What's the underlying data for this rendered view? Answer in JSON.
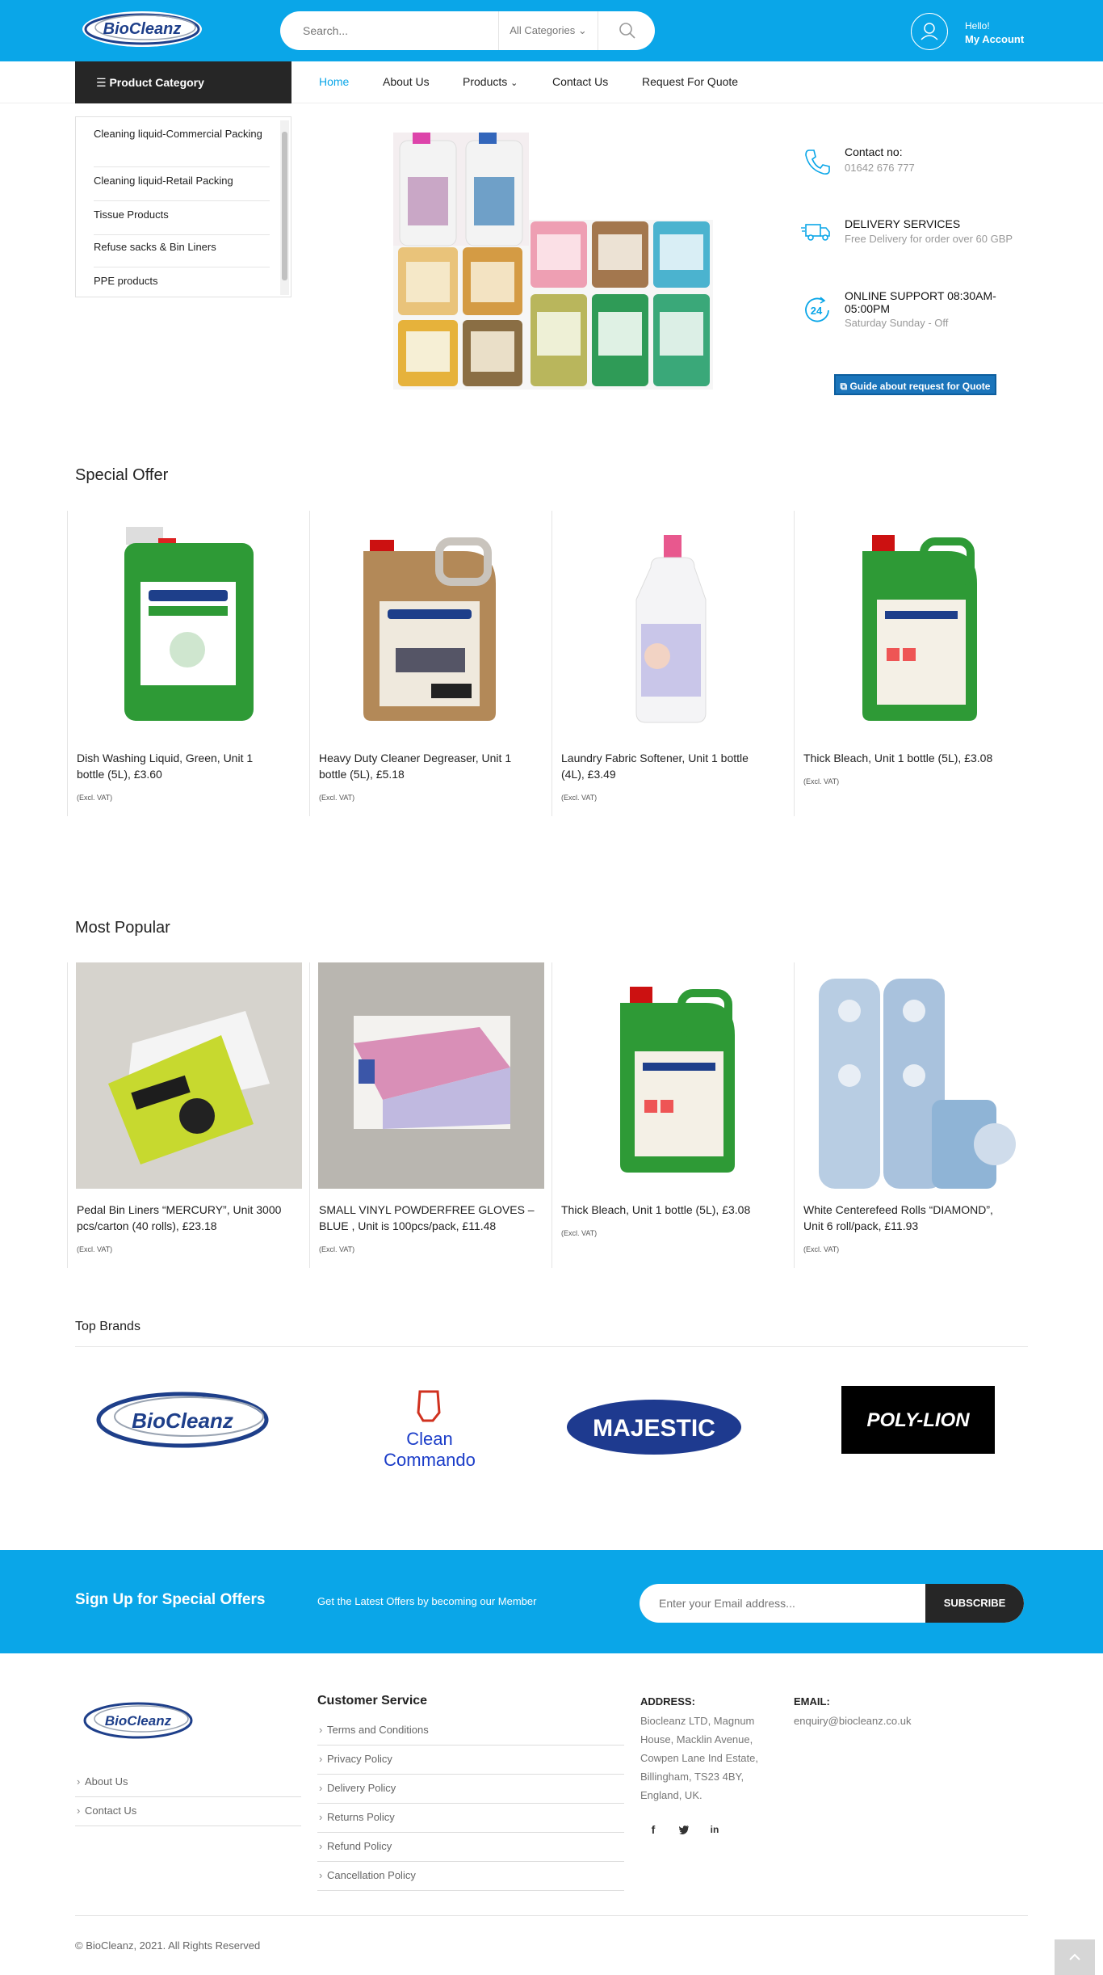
{
  "header": {
    "logo_text": "BioCleanz",
    "search_placeholder": "Search...",
    "category_select": "All Categories",
    "account_hello": "Hello!",
    "account_label": "My Account"
  },
  "nav": {
    "category_label": "Product Category",
    "links": [
      "Home",
      "About Us",
      "Products",
      "Contact Us",
      "Request For Quote"
    ]
  },
  "categories": [
    "Cleaning liquid-Commercial Packing",
    "Cleaning liquid-Retail Packing",
    "Tissue Products",
    "Refuse sacks & Bin Liners",
    "PPE products"
  ],
  "info": {
    "contact_title": "Contact no:",
    "contact_value": "01642 676 777",
    "delivery_title": "DELIVERY SERVICES",
    "delivery_sub": "Free Delivery for order over 60 GBP",
    "support_title_1": "ONLINE SUPPORT 08:30AM-",
    "support_title_2": "05:00PM",
    "support_sub": "Saturday Sunday - Off",
    "support_badge": "24",
    "guide_button": "Guide about request for Quote"
  },
  "special_offer": {
    "title": "Special Offer",
    "products": [
      {
        "title_1": "Dish Washing Liquid, Green, Unit 1",
        "title_2": "bottle (5L), £3.60",
        "vat": "(Excl. VAT)"
      },
      {
        "title_1": "Heavy Duty Cleaner Degreaser, Unit 1",
        "title_2": "bottle (5L), £5.18",
        "vat": "(Excl. VAT)"
      },
      {
        "title_1": "Laundry Fabric Softener, Unit 1 bottle",
        "title_2": "(4L), £3.49",
        "vat": "(Excl. VAT)"
      },
      {
        "title_1": "Thick Bleach, Unit 1 bottle (5L), £3.08",
        "title_2": "",
        "vat": "(Excl. VAT)"
      }
    ]
  },
  "most_popular": {
    "title": "Most Popular",
    "products": [
      {
        "title_1": "Pedal Bin Liners “MERCURY”, Unit 3000",
        "title_2": "pcs/carton (40 rolls), £23.18",
        "vat": "(Excl. VAT)"
      },
      {
        "title_1": "SMALL VINYL POWDERFREE GLOVES –",
        "title_2": "BLUE , Unit is 100pcs/pack, £11.48",
        "vat": "(Excl. VAT)"
      },
      {
        "title_1": "Thick Bleach, Unit 1 bottle (5L), £3.08",
        "title_2": "",
        "vat": "(Excl. VAT)"
      },
      {
        "title_1": "White Centerefeed Rolls “DIAMOND”,",
        "title_2": "Unit 6 roll/pack, £11.93",
        "vat": "(Excl. VAT)"
      }
    ]
  },
  "brands": {
    "title": "Top Brands",
    "items": [
      "BioCleanz",
      "Clean Commando",
      "MAJESTIC",
      "POLY-LION"
    ]
  },
  "newsletter": {
    "title": "Sign Up for Special Offers",
    "subtitle": "Get the Latest Offers by becoming our Member",
    "placeholder": "Enter your Email address...",
    "button": "SUBSCRIBE"
  },
  "footer": {
    "left_links": [
      "About Us",
      "Contact Us"
    ],
    "customer_service_title": "Customer Service",
    "customer_service_links": [
      "Terms and Conditions",
      "Privacy Policy",
      "Delivery Policy",
      "Returns Policy",
      "Refund Policy",
      "Cancellation Policy"
    ],
    "address_title": "ADDRESS:",
    "address_lines": [
      "Biocleanz LTD, Magnum",
      "House, Macklin Avenue,",
      "Cowpen Lane Ind Estate,",
      "Billingham, TS23 4BY,",
      "England, UK."
    ],
    "email_title": "EMAIL:",
    "email_value": "enquiry@biocleanz.co.uk",
    "copyright": "© BioCleanz, 2021. All Rights Reserved"
  },
  "colors": {
    "brand_blue": "#0aa6e8",
    "dark": "#262626",
    "button_blue": "#1b75bb"
  }
}
